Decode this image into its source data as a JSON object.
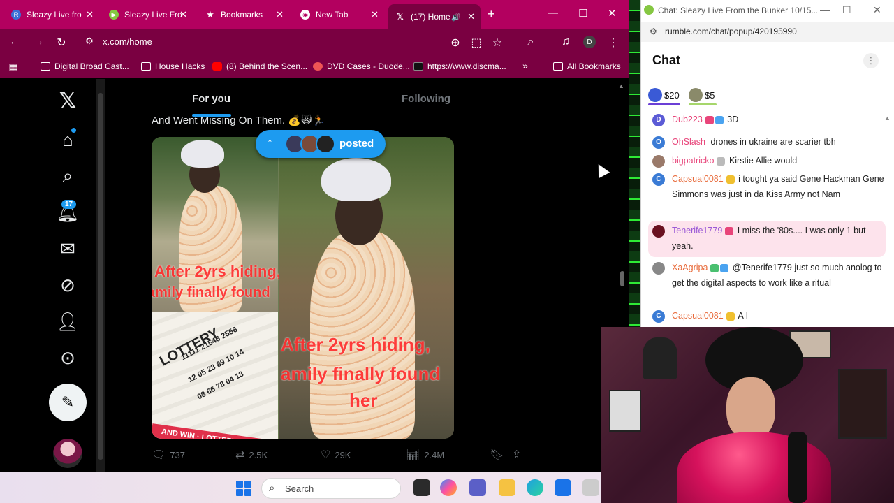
{
  "browser": {
    "tabs": [
      {
        "label": "Sleazy Live fro",
        "icon": "rumble-icon"
      },
      {
        "label": "Sleazy Live Fro",
        "icon": "rumble-icon"
      },
      {
        "label": "Bookmarks",
        "icon": "star-icon"
      },
      {
        "label": "New Tab",
        "icon": "chrome-icon"
      },
      {
        "label": "(17) Home",
        "icon": "x-icon"
      }
    ],
    "url": "x.com/home",
    "profile_initial": "D",
    "bookmarks": [
      "Digital Broad Cast...",
      "House Hacks",
      "(8) Behind the Scen...",
      "DVD Cases - Duode...",
      "https://www.discma..."
    ],
    "all_bookmarks": "All Bookmarks",
    "overflow": "»"
  },
  "x": {
    "tabs": {
      "for_you": "For you",
      "following": "Following"
    },
    "notification_count": "17",
    "tweet_text": "And Went Missing On Them. 💰🙀🏃",
    "posted_pill": "posted",
    "media_overlay_1": "After 2yrs hiding,",
    "media_overlay_2": "amily finally found",
    "media_overlay_3": "her",
    "lottery_word": "LOTTERY",
    "lottery_numbers": "11111 21546 2556",
    "lottery_numbers2": "12 05 23 89 10 14",
    "lottery_numbers3": "08 66 78 04 13",
    "lottery_band": "AND WIN · LOTTERY · PLAY",
    "actions": {
      "replies": "737",
      "reposts": "2.5K",
      "likes": "29K",
      "views": "2.4M"
    }
  },
  "taskbar": {
    "search_placeholder": "Search"
  },
  "chat": {
    "window_title": "Chat: Sleazy Live From the Bunker 10/15...",
    "url": "rumble.com/chat/popup/420195990",
    "header": "Chat",
    "rants": [
      {
        "amount": "$20",
        "color": "#6b3fd6"
      },
      {
        "amount": "$5",
        "color": "#4caf50"
      }
    ],
    "messages": [
      {
        "user": "Dub223",
        "user_color": "#e8457a",
        "avatar": "D",
        "avatar_color": "#5b5bd6",
        "text": "3D",
        "highlight": false
      },
      {
        "user": "OhSlash",
        "user_color": "#e8457a",
        "avatar": "O",
        "avatar_color": "#3a7bd5",
        "text": "drones in ukraine are scarier tbh",
        "highlight": false
      },
      {
        "user": "bigpatricko",
        "user_color": "#e8457a",
        "avatar": "",
        "avatar_color": "#9a7a6a",
        "text": "Kirstie Allie would",
        "highlight": false
      },
      {
        "user": "Capsual0081",
        "user_color": "#e86a3a",
        "avatar": "C",
        "avatar_color": "#3a7bd5",
        "text": "i tought ya said Gene Hackman Gene Simmons was just in da Kiss Army not Nam",
        "highlight": false
      },
      {
        "user": "Tenerife1779",
        "user_color": "#9b59d6",
        "avatar": "",
        "avatar_color": "#6a1020",
        "text": "I miss the '80s.... I was only 1 but yeah.",
        "highlight": true
      },
      {
        "user": "XaAgripa",
        "user_color": "#e86a3a",
        "avatar": "",
        "avatar_color": "#888",
        "text": "@Tenerife1779 just so much anolog to get the digital aspects to work like a ritual",
        "highlight": false
      },
      {
        "user": "Capsual0081",
        "user_color": "#e86a3a",
        "avatar": "C",
        "avatar_color": "#3a7bd5",
        "text": "A I",
        "highlight": false
      }
    ]
  }
}
